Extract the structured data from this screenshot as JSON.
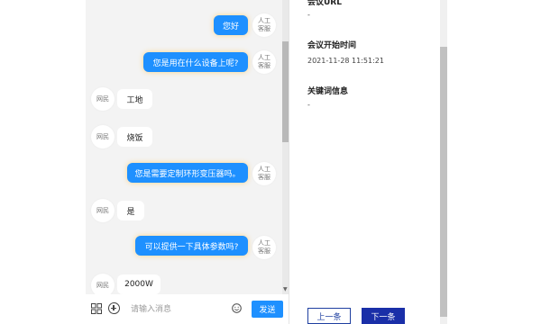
{
  "messages": [
    {
      "from": "agent",
      "text": "您好",
      "avatar": [
        "人工",
        "客服"
      ]
    },
    {
      "from": "agent",
      "text": "您是用在什么设备上呢?",
      "avatar": [
        "人工",
        "客服"
      ]
    },
    {
      "from": "user",
      "text": "工地",
      "avatar": "网民"
    },
    {
      "from": "user",
      "text": "烧饭",
      "avatar": "网民"
    },
    {
      "from": "agent",
      "text": "您是需要定制环形变压器吗。",
      "avatar": [
        "人工",
        "客服"
      ]
    },
    {
      "from": "user",
      "text": "是",
      "avatar": "网民"
    },
    {
      "from": "agent",
      "text": "可以提供一下具体参数吗?",
      "avatar": [
        "人工",
        "客服"
      ]
    },
    {
      "from": "user",
      "text": "2000W",
      "avatar": "网民"
    }
  ],
  "input": {
    "placeholder": "请输入消息",
    "send_label": "发送"
  },
  "info": {
    "top_label": "会议URL",
    "top_value": "-",
    "meeting_start_label": "会议开始时间",
    "meeting_start_value": "2021-11-28 11:51:21",
    "keyword_label": "关键词信息",
    "keyword_value": "-"
  },
  "nav": {
    "prev_label": "上一条",
    "next_label": "下一条"
  },
  "colors": {
    "agent_bubble": "#1e90ff",
    "next_button": "#1a2fa8",
    "chat_bg": "#f3f3f3"
  },
  "icons": {
    "apps": "apps-grid-icon",
    "add": "plus-circle-icon",
    "emoji": "smile-icon"
  }
}
